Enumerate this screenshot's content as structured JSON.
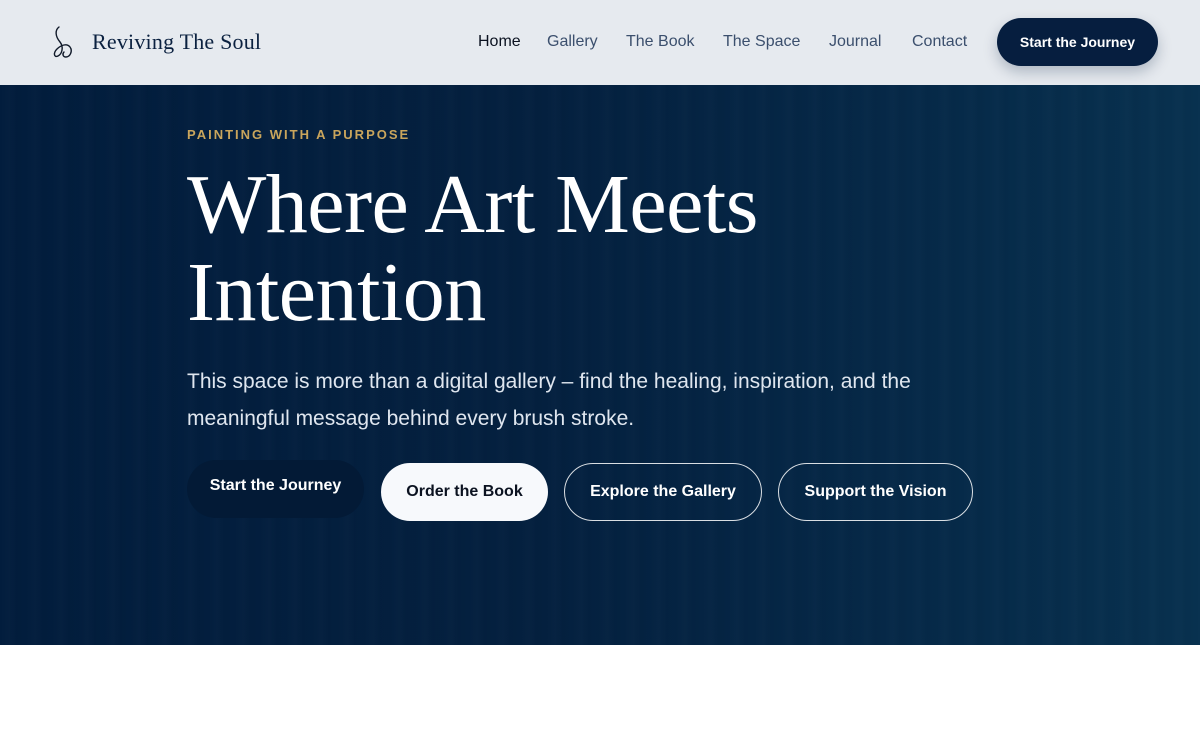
{
  "header": {
    "brand_name": "Reviving The Soul",
    "brand_icon": "signature-logo-icon",
    "nav": [
      {
        "label": "Home",
        "active": true
      },
      {
        "label": "Gallery",
        "active": false
      },
      {
        "label": "The Book",
        "active": false
      },
      {
        "label": "The Space",
        "active": false
      },
      {
        "label": "Journal",
        "active": false
      },
      {
        "label": "Contact",
        "active": false
      }
    ],
    "cta_label": "Start the Journey"
  },
  "hero": {
    "eyebrow": "PAINTING WITH A PURPOSE",
    "headline": "Where Art Meets Intention",
    "lead": "This space is more than a digital gallery – find the healing, inspiration, and the meaningful message behind every brush stroke.",
    "buttons": {
      "start": "Start the Journey",
      "order": "Order the Book",
      "explore": "Explore the Gallery",
      "support": "Support the Vision"
    }
  },
  "colors": {
    "hero_bg": "#021d3d",
    "header_bg": "#e6eaef",
    "accent_gold": "#c9a55c",
    "navy": "#061e3f"
  }
}
